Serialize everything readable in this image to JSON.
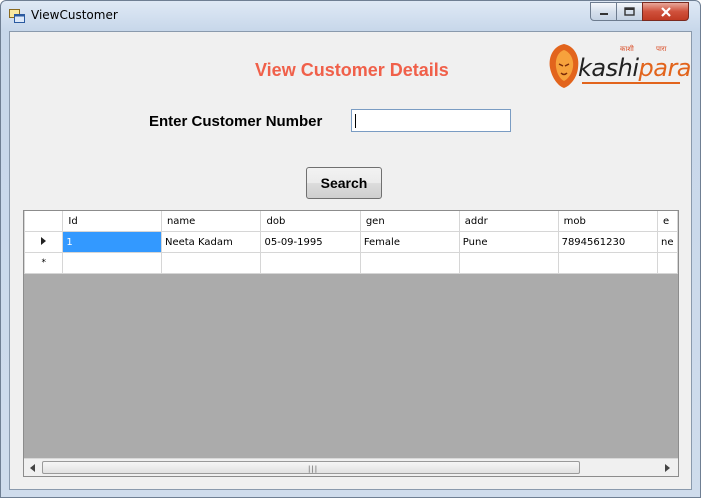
{
  "window": {
    "title": "ViewCustomer",
    "icon": "form-icon",
    "controls": [
      "minimize-icon",
      "maximize-icon",
      "close-icon"
    ]
  },
  "header": {
    "heading": "View Customer Details",
    "heading_color": "#f0604a"
  },
  "logo": {
    "text_main": "kashi",
    "text_accent": "para",
    "tagline_left": "काशी",
    "tagline_right": "पारा",
    "accent_color": "#e2641c"
  },
  "form": {
    "label": "Enter Customer Number",
    "input_value": "",
    "search_label": "Search"
  },
  "grid": {
    "columns": [
      "Id",
      "name",
      "dob",
      "gen",
      "addr",
      "mob",
      "e"
    ],
    "rows": [
      {
        "cells": [
          "1",
          "Neeta Kadam",
          "05-09-1995",
          "Female",
          "Pune",
          "7894561230",
          "ne"
        ]
      }
    ],
    "new_row_marker": "*",
    "selection_color": "#3399ff"
  }
}
